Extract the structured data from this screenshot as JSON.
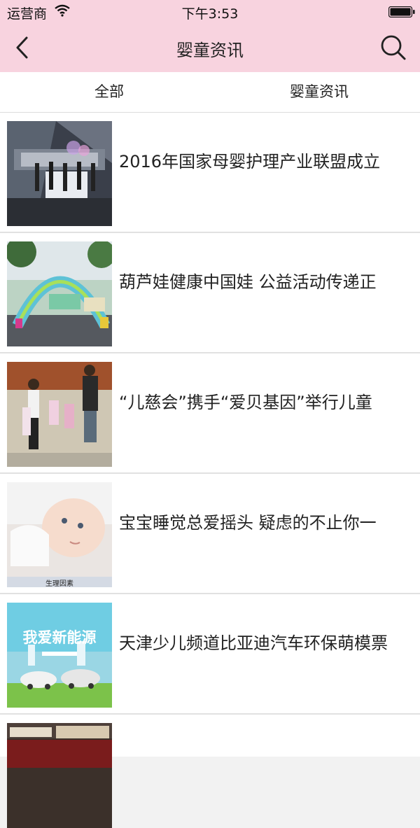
{
  "status_bar": {
    "carrier": "运营商",
    "time": "下午3:53"
  },
  "nav": {
    "title": "婴童资讯",
    "back_icon": "chevron-left-icon",
    "search_icon": "search-icon"
  },
  "tabs": [
    {
      "label": "全部"
    },
    {
      "label": "婴童资讯"
    }
  ],
  "articles": [
    {
      "title": "2016年国家母婴护理产业联盟成立"
    },
    {
      "title": "葫芦娃健康中国娃 公益活动传递正"
    },
    {
      "title": "“儿慈会”携手“爱贝基因”举行儿童"
    },
    {
      "title": "宝宝睡觉总爱摇头 疑虑的不止你一",
      "image_caption": "生理因素"
    },
    {
      "title": "天津少儿频道比亚迪汽车环保萌模票",
      "image_caption": "我爱新能源"
    },
    {
      "title": ""
    }
  ],
  "colors": {
    "header_bg": "#f8d3df",
    "list_bg": "#ffffff",
    "divider": "#e1e1e1"
  }
}
